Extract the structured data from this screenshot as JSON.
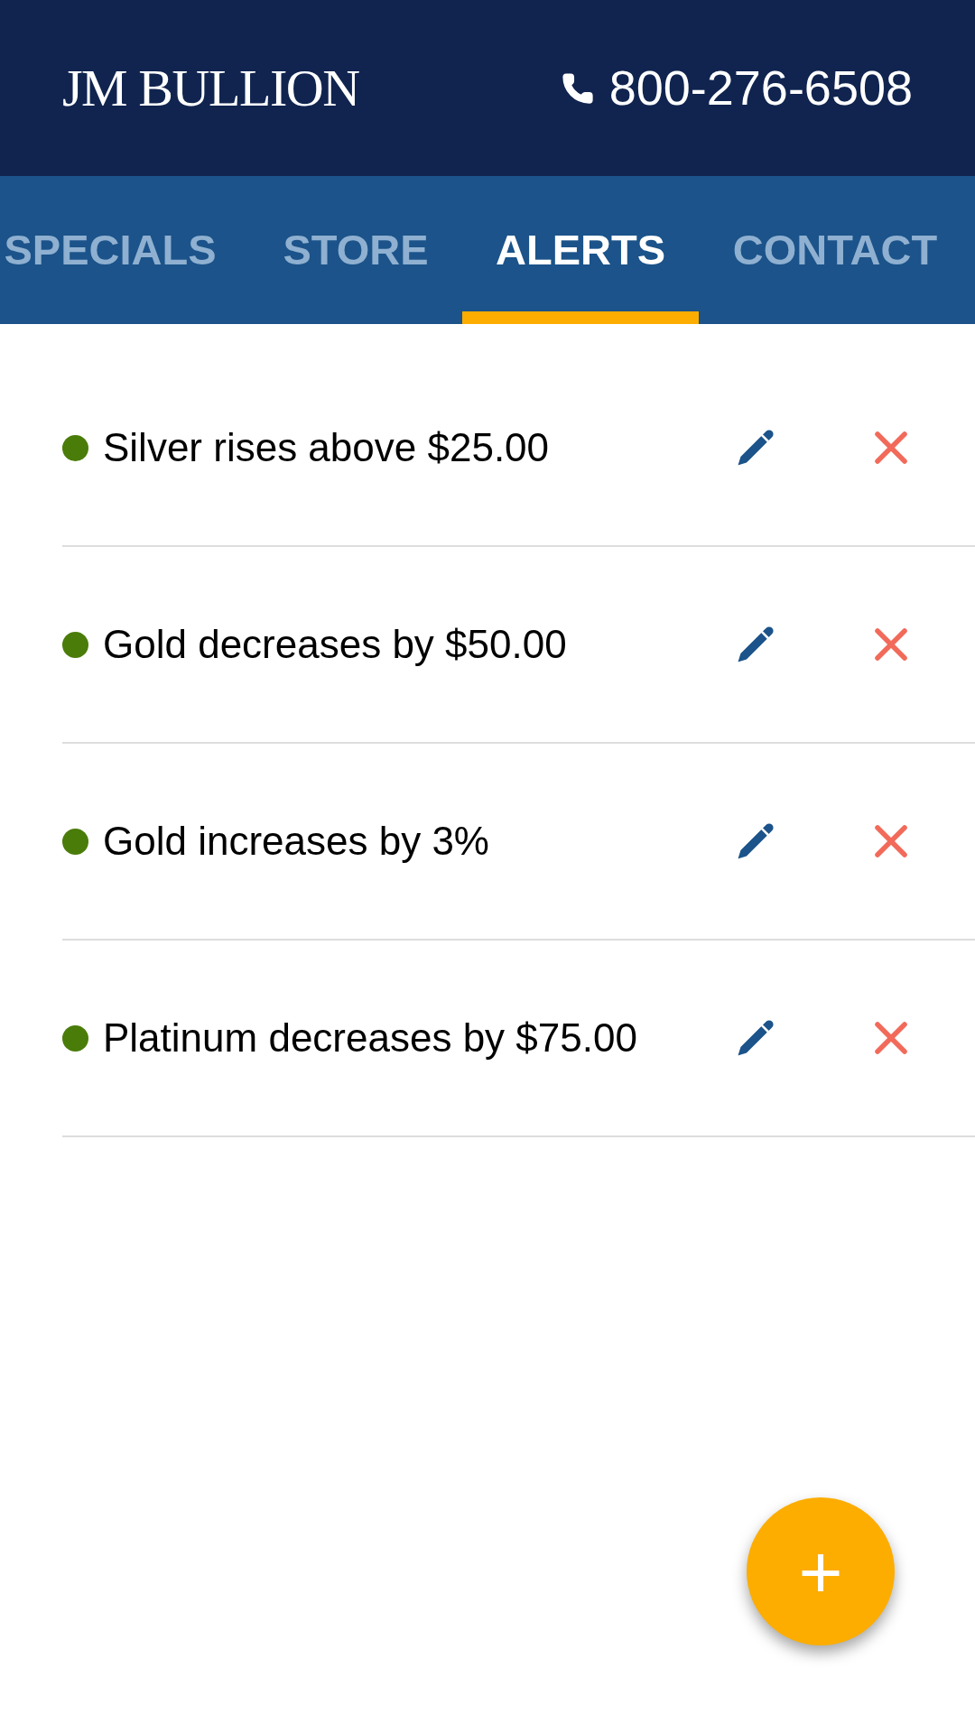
{
  "header": {
    "logo": "JM BULLION",
    "phone": "800-276-6508"
  },
  "tabs": [
    {
      "label": "SPECIALS",
      "selected": false
    },
    {
      "label": "STORE",
      "selected": false
    },
    {
      "label": "ALERTS",
      "selected": true
    },
    {
      "label": "CONTACT",
      "selected": false
    }
  ],
  "alerts": [
    {
      "text": "Silver rises above $25.00",
      "color": "#4a7c0a"
    },
    {
      "text": "Gold decreases by $50.00",
      "color": "#4a7c0a"
    },
    {
      "text": "Gold increases by 3%",
      "color": "#4a7c0a"
    },
    {
      "text": "Platinum decreases by $75.00",
      "color": "#4a7c0a"
    }
  ],
  "fab": {
    "label": "+"
  }
}
